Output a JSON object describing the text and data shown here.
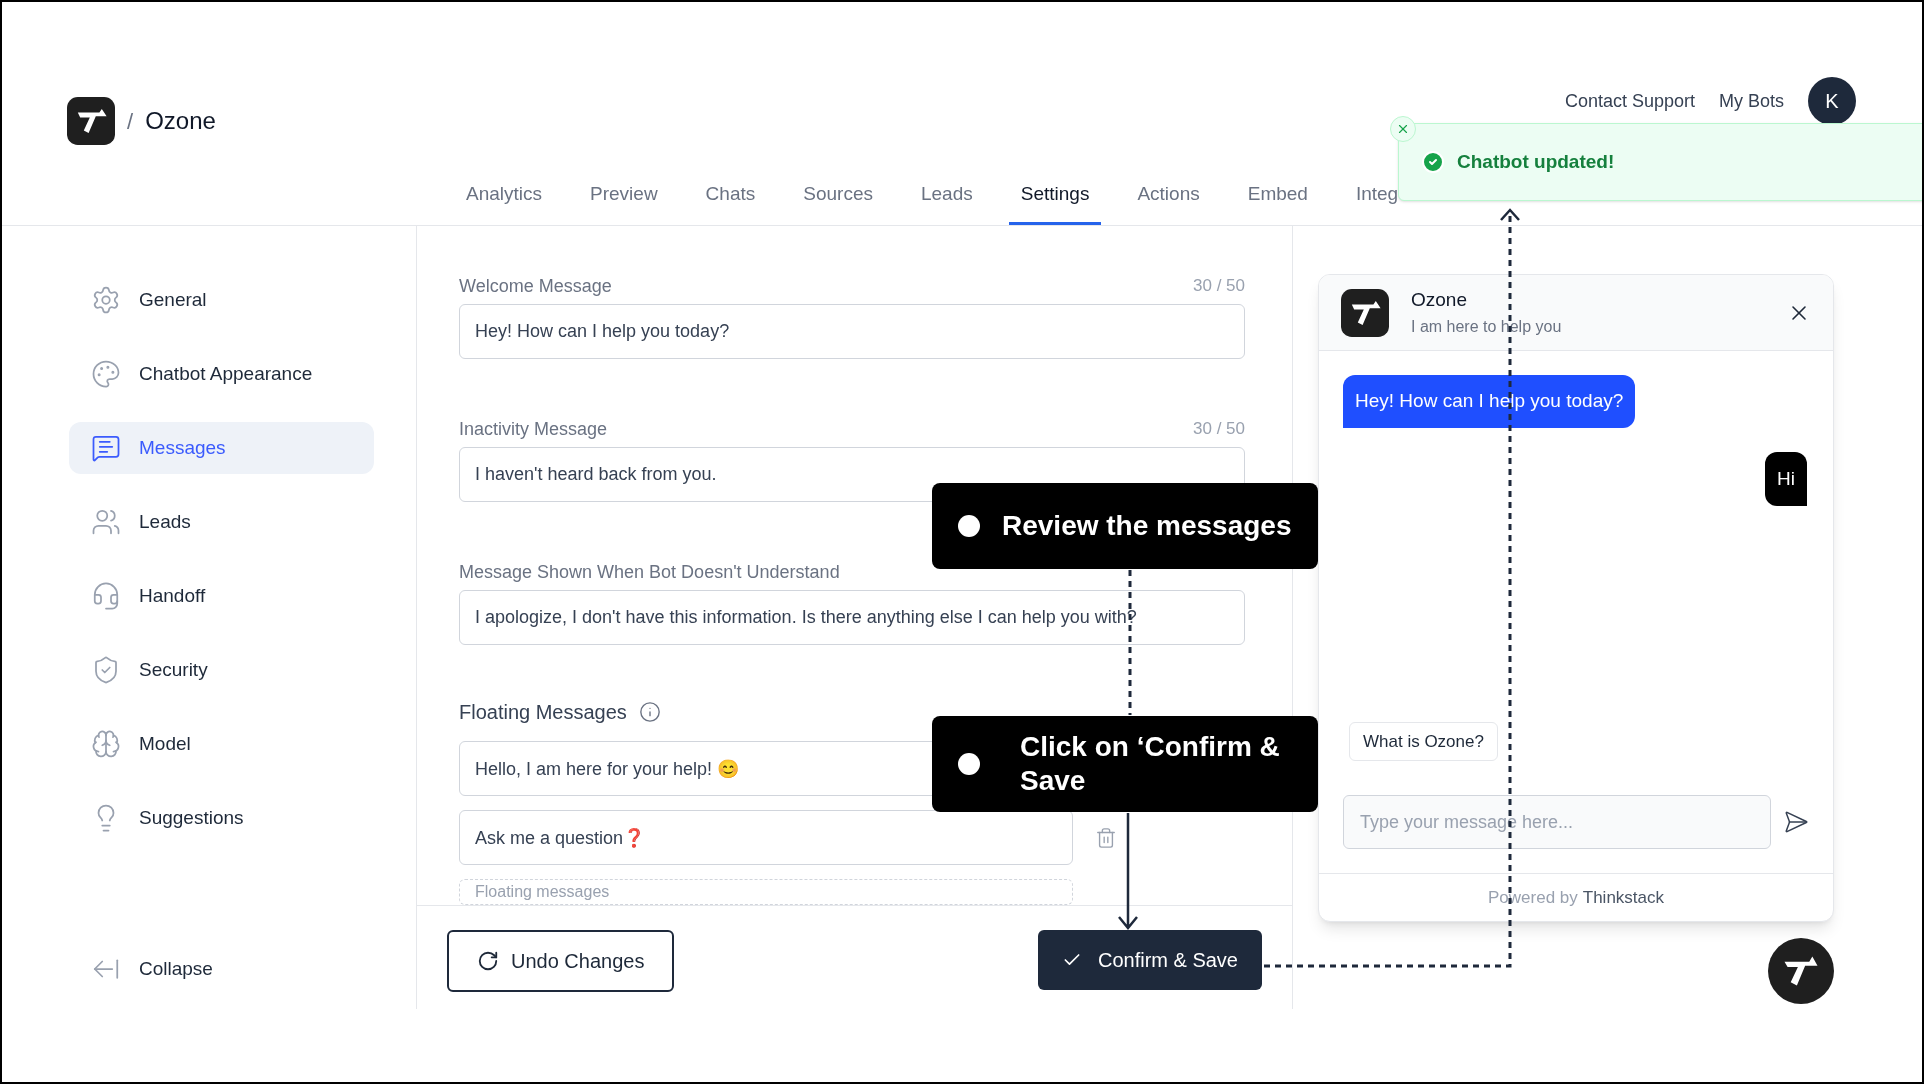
{
  "brand": {
    "separator": "/",
    "name": "Ozone"
  },
  "top_links": [
    "Contact Support",
    "My Bots"
  ],
  "avatar": "K",
  "tabs": [
    {
      "label": "Analytics",
      "selected": false
    },
    {
      "label": "Preview",
      "selected": false
    },
    {
      "label": "Chats",
      "selected": false
    },
    {
      "label": "Sources",
      "selected": false
    },
    {
      "label": "Leads",
      "selected": false
    },
    {
      "label": "Settings",
      "selected": true
    },
    {
      "label": "Actions",
      "selected": false
    },
    {
      "label": "Embed",
      "selected": false
    },
    {
      "label": "Integ",
      "selected": false
    }
  ],
  "toast": {
    "message": "Chatbot updated!"
  },
  "sidebar": {
    "items": [
      {
        "label": "General",
        "selected": false
      },
      {
        "label": "Chatbot Appearance",
        "selected": false
      },
      {
        "label": "Messages",
        "selected": true
      },
      {
        "label": "Leads",
        "selected": false
      },
      {
        "label": "Handoff",
        "selected": false
      },
      {
        "label": "Security",
        "selected": false
      },
      {
        "label": "Model",
        "selected": false
      },
      {
        "label": "Suggestions",
        "selected": false
      }
    ],
    "collapse": "Collapse"
  },
  "fields": [
    {
      "label": "Welcome Message",
      "count": "30 / 50",
      "value": "Hey! How can I help you today?"
    },
    {
      "label": "Inactivity Message",
      "count": "30 / 50",
      "value": "I haven't heard back from you."
    },
    {
      "label": "Message Shown When Bot Doesn't Understand",
      "value": "I apologize, I don't have this information. Is there anything else I can help you with?"
    }
  ],
  "floating": {
    "title": "Floating Messages",
    "messages": [
      "Hello, I am here for your help! 😊",
      "Ask me a question❓"
    ],
    "placeholder": "Floating messages"
  },
  "footer": {
    "undo": "Undo Changes",
    "confirm": "Confirm & Save"
  },
  "callouts": [
    "Review the messages",
    "Click on ‘Confirm & Save"
  ],
  "chat": {
    "name": "Ozone",
    "subtitle": "I am here to help you",
    "messages": [
      {
        "kind": "bot",
        "text": "Hey! How can I help you today?"
      },
      {
        "kind": "user",
        "text": "Hi"
      }
    ],
    "suggestion": "What is Ozone?",
    "placeholder": "Type your message here...",
    "powered_by": "Powered by",
    "powered_brand": "Thinkstack"
  }
}
